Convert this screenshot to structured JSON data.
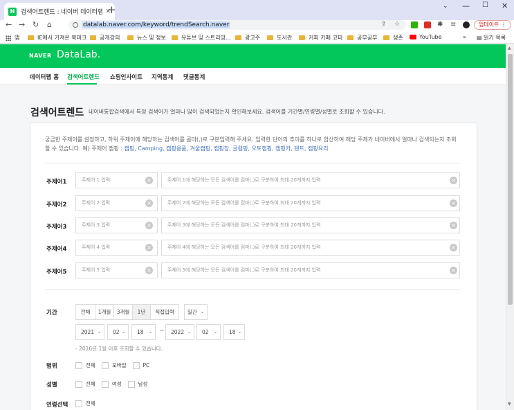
{
  "browser": {
    "tab_title": "검색어트렌드 : 네이버 데이터랩",
    "url": "datalab.naver.com/keyword/trendSearch.naver",
    "update_label": "업데이트"
  },
  "bookmarks": {
    "items": [
      "앱",
      "IE에서 가져온 북마크",
      "공개강의",
      "뉴스 및 정보",
      "유튜브 및 스트리밍...",
      "광고주",
      "도서관",
      "커피 카페 코피",
      "공부공부",
      "생존",
      "YouTube"
    ],
    "more": "»",
    "reading_list": "읽기 목록"
  },
  "site": {
    "logo_naver": "NAVER",
    "logo_datalab": "DataLab.",
    "nav": [
      "데이터랩 홈",
      "검색어트렌드",
      "쇼핑인사이트",
      "지역통계",
      "댓글통계"
    ]
  },
  "page": {
    "title": "검색어트렌드",
    "description": "네이버통합검색에서 특정 검색어가 얼마나 많이 검색되었는지 확인해보세요. 검색어를 기간별/연령별/성별로 조회할 수 있습니다.",
    "intro": "궁금한 주제어를 설정하고, 하위 주제어에 해당하는 검색어를 콤마(,)로 구분입력해 주세요. 입력한 단어의 추이를 하나로 합산하여 해당 주제가 네이버에서 얼마나 검색되는지 조회할 수 있습니다. 예) 주제어 캠핑 :",
    "intro_examples": "캠핑, Camping, 캠핑용품, 겨울캠핑, 캠핑장, 글램핑, 오토캠핑, 캠핑카, 텐트, 캠핑요리"
  },
  "topics": [
    {
      "label": "주제어1",
      "placeholder": "주제어 1 입력",
      "kw_placeholder": "주제어 1에 해당하는 모든 검색어를 컴마(,)로 구분하여 최대 20개까지 입력"
    },
    {
      "label": "주제어2",
      "placeholder": "주제어 2 입력",
      "kw_placeholder": "주제어 2에 해당하는 모든 검색어를 컴마(,)로 구분하여 최대 20개까지 입력"
    },
    {
      "label": "주제어3",
      "placeholder": "주제어 3 입력",
      "kw_placeholder": "주제어 3에 해당하는 모든 검색어를 컴마(,)로 구분하여 최대 20개까지 입력"
    },
    {
      "label": "주제어4",
      "placeholder": "주제어 4 입력",
      "kw_placeholder": "주제어 4에 해당하는 모든 검색어를 컴마(,)로 구분하여 최대 20개까지 입력"
    },
    {
      "label": "주제어5",
      "placeholder": "주제어 5 입력",
      "kw_placeholder": "주제어 5에 해당하는 모든 검색어를 컴마(,)로 구분하여 최대 20개까지 입력"
    }
  ],
  "period": {
    "label": "기간",
    "options": [
      "전체",
      "1개월",
      "3개월",
      "1년",
      "직접입력"
    ],
    "selected": "1년",
    "unit": "일간",
    "start": {
      "year": "2021",
      "month": "02",
      "day": "18"
    },
    "end": {
      "year": "2022",
      "month": "02",
      "day": "18"
    },
    "tilde": "~",
    "note": "- 2016년 1월 이후 조회할 수 있습니다."
  },
  "range": {
    "label": "범위",
    "options": [
      "전체",
      "모바일",
      "PC"
    ]
  },
  "gender": {
    "label": "성별",
    "options": [
      "전체",
      "여성",
      "남성"
    ]
  },
  "age": {
    "label": "연령선택",
    "options": [
      "전체"
    ]
  }
}
